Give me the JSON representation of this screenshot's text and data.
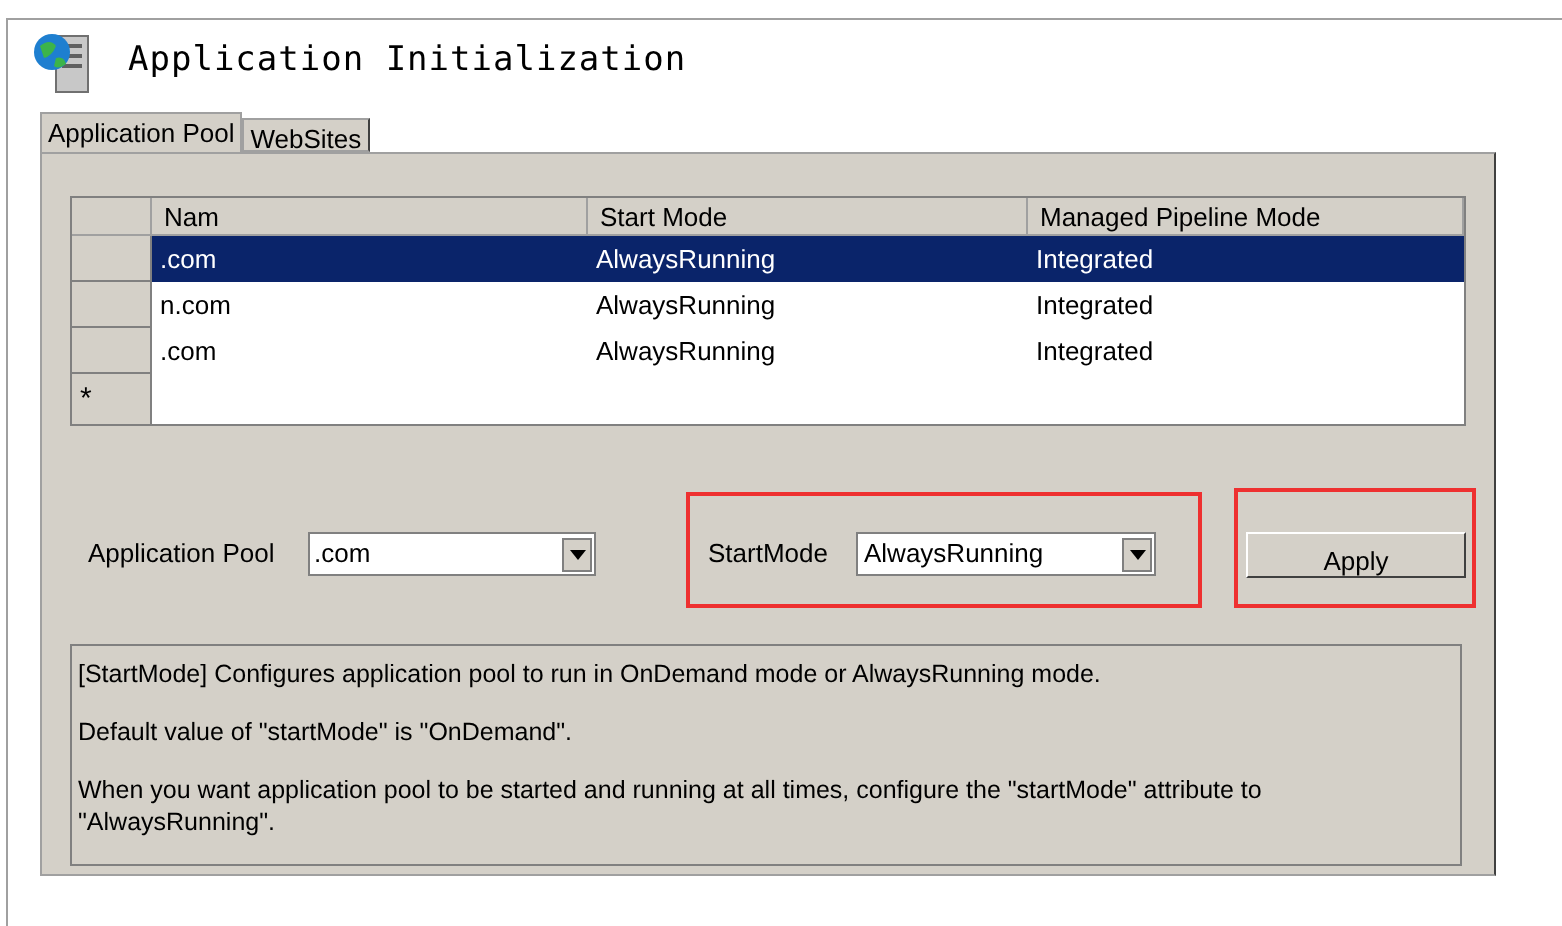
{
  "window": {
    "title": "Application Initialization"
  },
  "tabs": [
    {
      "label": "Application Pool",
      "selected": true
    },
    {
      "label": "WebSites",
      "selected": false
    }
  ],
  "table": {
    "columns": [
      "Nam",
      "Start Mode",
      "Managed Pipeline Mode"
    ],
    "rows": [
      {
        "cells": [
          ".com",
          "AlwaysRunning",
          "Integrated"
        ],
        "selected": true
      },
      {
        "cells": [
          "n.com",
          "AlwaysRunning",
          "Integrated"
        ],
        "selected": false
      },
      {
        "cells": [
          ".com",
          "AlwaysRunning",
          "Integrated"
        ],
        "selected": false
      }
    ],
    "new_row_marker": "*"
  },
  "pool": {
    "label": "Application Pool",
    "value": ".com"
  },
  "start_mode": {
    "label": "StartMode",
    "value": "AlwaysRunning"
  },
  "apply_button": "Apply",
  "description": [
    "[StartMode] Configures application pool to run in OnDemand mode or AlwaysRunning mode.",
    "Default value of \"startMode\" is \"OnDemand\".",
    "When you want application pool to be started and running at all times, configure the \"startMode\" attribute to \"AlwaysRunning\"."
  ]
}
